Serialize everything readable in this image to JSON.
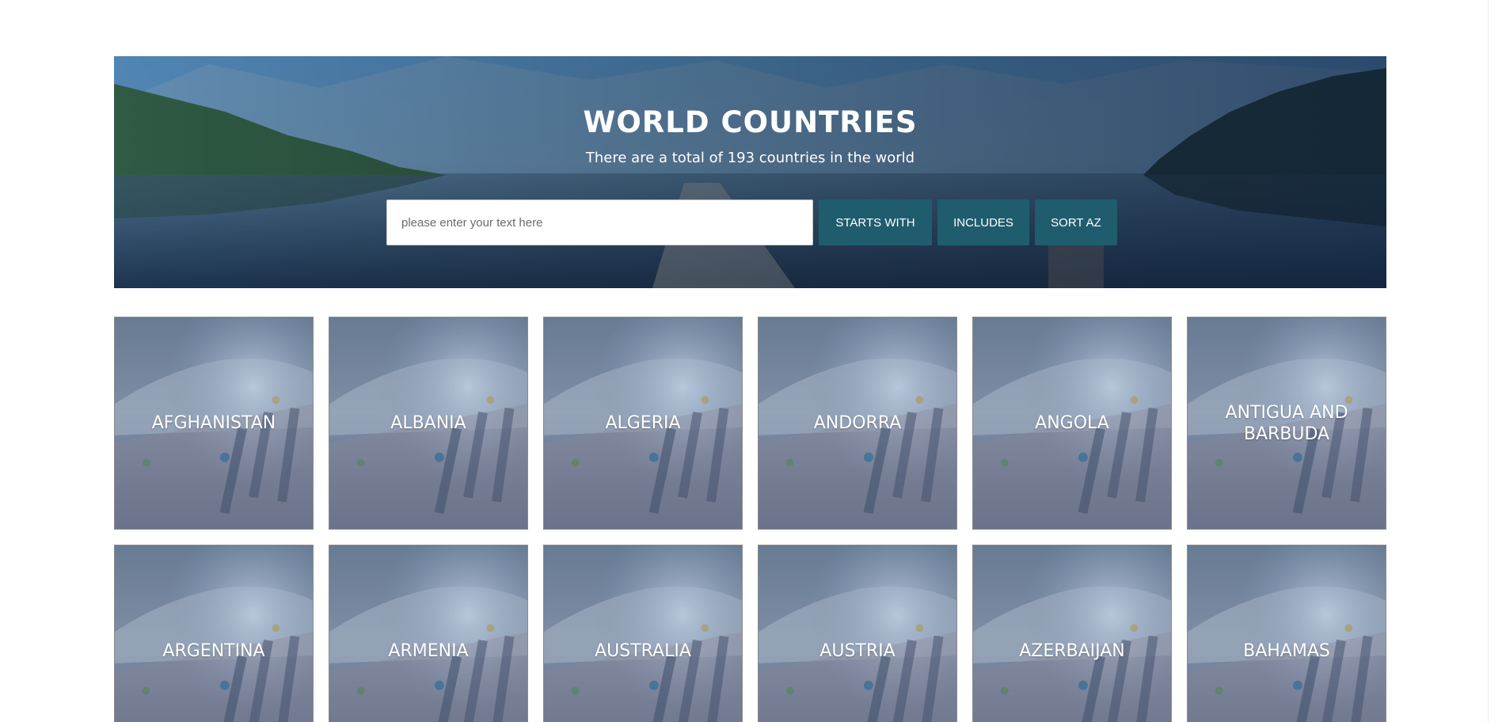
{
  "header": {
    "title": "WORLD COUNTRIES",
    "subtitle": "There are a total of 193 countries in the world"
  },
  "search": {
    "placeholder": "please enter your text here",
    "value": ""
  },
  "buttons": {
    "starts_with": "STARTS WITH",
    "includes": "INCLUDES",
    "sort": "SORT AZ"
  },
  "colors": {
    "button_bg": "#1f5c6e",
    "hero_overlay": "#3f7bb0",
    "card_overlay": "#6d7f99"
  },
  "countries": [
    "AFGHANISTAN",
    "ALBANIA",
    "ALGERIA",
    "ANDORRA",
    "ANGOLA",
    "ANTIGUA AND BARBUDA",
    "ARGENTINA",
    "ARMENIA",
    "AUSTRALIA",
    "AUSTRIA",
    "AZERBAIJAN",
    "BAHAMAS"
  ]
}
